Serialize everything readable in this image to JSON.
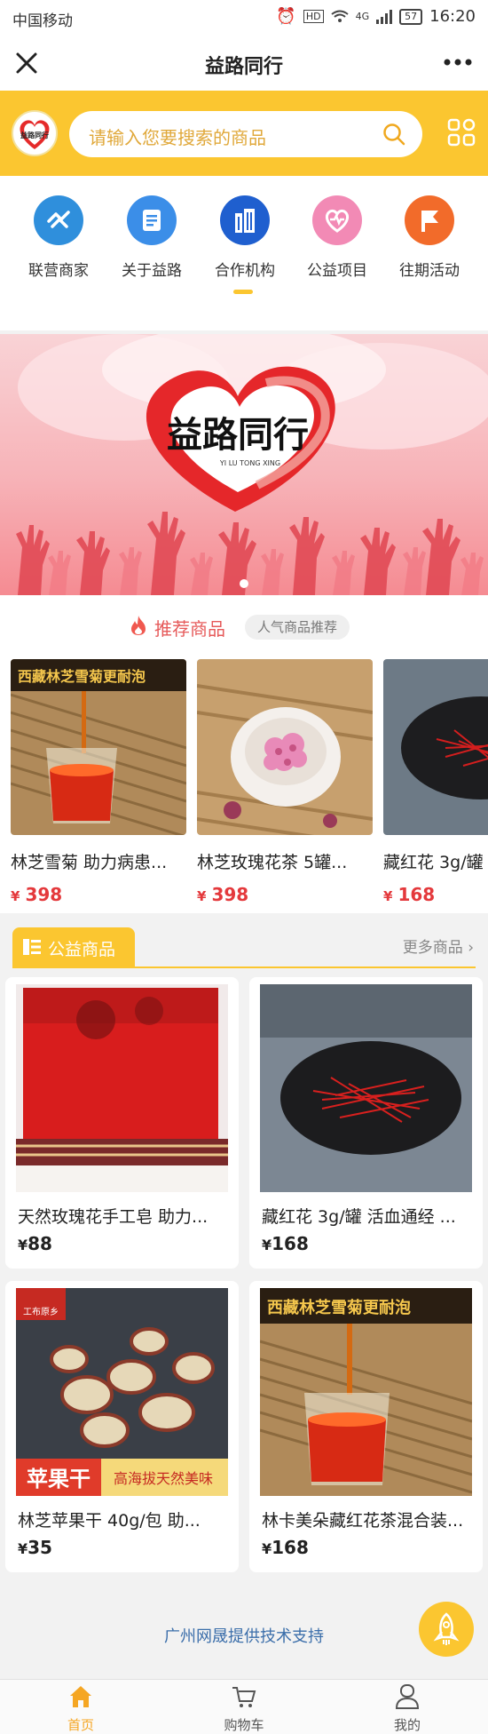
{
  "status_bar": {
    "carrier": "中国移动",
    "network": "4G",
    "battery": "57",
    "time": "16:20"
  },
  "title_bar": {
    "title": "益路同行"
  },
  "logo": {
    "text": "益路同行"
  },
  "search": {
    "placeholder": "请输入您要搜索的商品"
  },
  "nav": {
    "items": [
      {
        "label": "联营商家",
        "icon": "handshake-icon",
        "color": "#2f8fdc"
      },
      {
        "label": "关于益路",
        "icon": "document-icon",
        "color": "#3b8ee8"
      },
      {
        "label": "合作机构",
        "icon": "building-icon",
        "color": "#1f5fcf"
      },
      {
        "label": "公益项目",
        "icon": "heart-icon",
        "color": "#f28ab5"
      },
      {
        "label": "往期活动",
        "icon": "flag-icon",
        "color": "#f26b2a"
      }
    ]
  },
  "banner": {
    "title": "益路同行",
    "subtitle": "YI LU TONG XING"
  },
  "recommended": {
    "title": "推荐商品",
    "tag": "人气商品推荐",
    "currency": "¥",
    "items": [
      {
        "name": "林芝雪菊 助力病患...",
        "price": "398",
        "image_text": "西藏林芝雪菊更耐泡"
      },
      {
        "name": "林芝玫瑰花茶 5罐...",
        "price": "398"
      },
      {
        "name": "藏红花 3g/罐",
        "price": "168"
      }
    ]
  },
  "public_goods": {
    "title": "公益商品",
    "more": "更多商品",
    "currency": "¥",
    "items": [
      {
        "name": "天然玫瑰花手工皂 助力...",
        "price": "88"
      },
      {
        "name": "藏红花 3g/罐 活血通经 ...",
        "price": "168"
      },
      {
        "name": "林芝苹果干 40g/包 助...",
        "price": "35",
        "image_text_1": "苹果干",
        "image_text_2": "高海拔天然美味",
        "image_text_3": "工布原乡"
      },
      {
        "name": "林卡美朵藏红花茶混合装...",
        "price": "168",
        "image_text": "西藏林芝雪菊更耐泡"
      }
    ]
  },
  "footer": {
    "support": "广州网晟提供技术支持"
  },
  "tabbar": {
    "items": [
      {
        "label": "首页",
        "active": true
      },
      {
        "label": "购物车",
        "active": false
      },
      {
        "label": "我的",
        "active": false
      }
    ]
  },
  "colors": {
    "accent": "#fbc630",
    "price_red": "#e4393c",
    "title_red": "#e65a5a",
    "link_blue": "#3b6eaa"
  }
}
